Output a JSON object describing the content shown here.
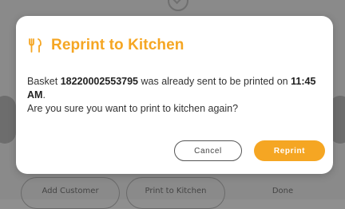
{
  "background": {
    "buttons": [
      "Add Customer",
      "Print to Kitchen",
      "Done"
    ]
  },
  "dialog": {
    "title": "Reprint to Kitchen",
    "icon": "fork-knife-icon",
    "message": {
      "prefix": "Basket ",
      "basket_number": "18220002553795",
      "middle": " was already sent to be printed on ",
      "time": "11:45 AM",
      "suffix": ".",
      "question": "Are you sure you want to print to kitchen again?"
    },
    "cancel_label": "Cancel",
    "confirm_label": "Reprint"
  },
  "colors": {
    "accent": "#f5a623",
    "overlay": "#8a8a8a"
  }
}
